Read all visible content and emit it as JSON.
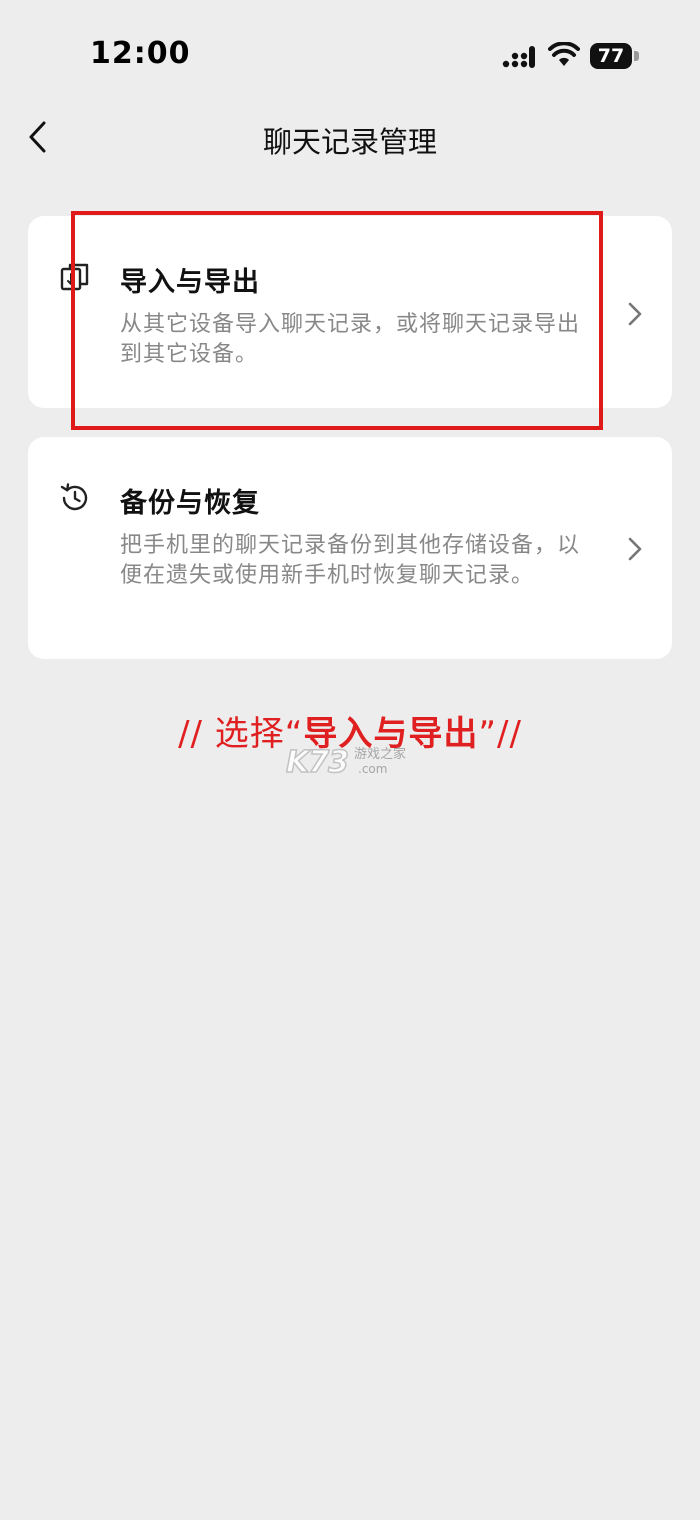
{
  "status_bar": {
    "time": "12:00",
    "battery": "77",
    "icons": [
      "signal-icon",
      "wifi-icon",
      "battery-icon"
    ]
  },
  "nav": {
    "title": "聊天记录管理",
    "back_icon": "chevron-left-icon"
  },
  "cards": [
    {
      "icon": "import-export-icon",
      "title": "导入与导出",
      "description": "从其它设备导入聊天记录，或将聊天记录导出到其它设备。"
    },
    {
      "icon": "history-icon",
      "title": "备份与恢复",
      "description": "把手机里的聊天记录备份到其他存储设备，以便在遗失或使用新手机时恢复聊天记录。"
    }
  ],
  "annotation": {
    "prefix": "// 选择“",
    "highlight": "导入与导出",
    "suffix": "”//",
    "color": "#e02020"
  },
  "watermark": {
    "logo": "K73",
    "text": "游戏之家",
    "domain": ".com"
  },
  "colors": {
    "background": "#ededed",
    "card": "#ffffff",
    "accent_red": "#e01919",
    "secondary_text": "#888888"
  }
}
